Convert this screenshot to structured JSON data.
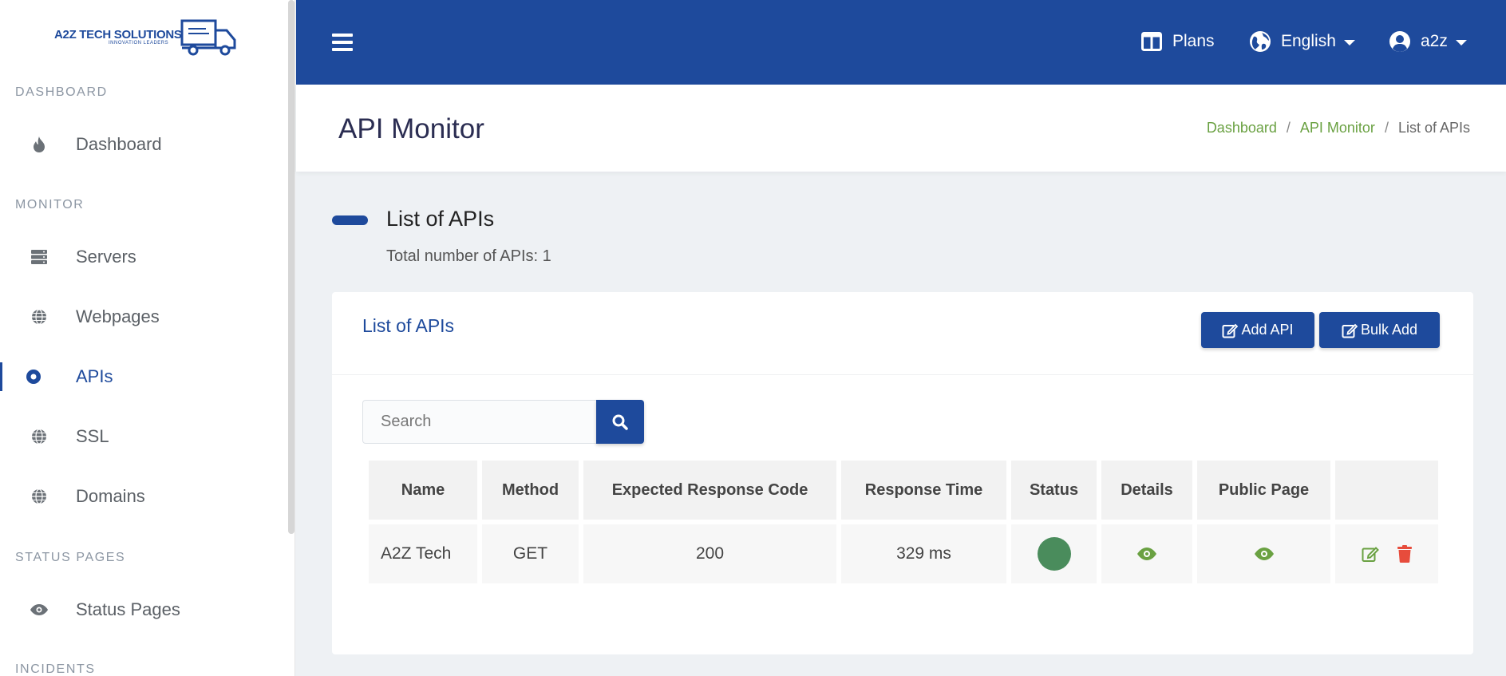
{
  "colors": {
    "primary": "#1e4a9c",
    "accent_green": "#6aa142",
    "status_up": "#4a8c5c",
    "danger": "#e74c3c"
  },
  "logo": {
    "brand": "A2Z TECH SOLUTIONS",
    "tagline": "INNOVATION LEADERS"
  },
  "sidebar": {
    "sections": {
      "dashboard": "DASHBOARD",
      "monitor": "MONITOR",
      "status_pages": "STATUS PAGES",
      "incidents": "INCIDENTS"
    },
    "items": [
      {
        "label": "Dashboard",
        "icon": "fire-icon"
      },
      {
        "label": "Servers",
        "icon": "server-icon"
      },
      {
        "label": "Webpages",
        "icon": "globe-icon"
      },
      {
        "label": "APIs",
        "icon": "dot-circle-icon",
        "active": true
      },
      {
        "label": "SSL",
        "icon": "globe-icon"
      },
      {
        "label": "Domains",
        "icon": "globe-icon"
      },
      {
        "label": "Status Pages",
        "icon": "eye-icon"
      }
    ]
  },
  "topbar": {
    "plans": "Plans",
    "language": "English",
    "user": "a2z"
  },
  "header": {
    "title": "API Monitor",
    "breadcrumb": [
      "Dashboard",
      "API Monitor",
      "List of APIs"
    ]
  },
  "section": {
    "title": "List of APIs",
    "subtitle": "Total number of APIs: 1"
  },
  "card": {
    "title": "List of APIs",
    "add_button": "Add API",
    "bulk_button": "Bulk Add",
    "search_placeholder": "Search"
  },
  "table": {
    "headers": [
      "Name",
      "Method",
      "Expected Response Code",
      "Response Time",
      "Status",
      "Details",
      "Public Page",
      ""
    ],
    "rows": [
      {
        "name": "A2Z Tech",
        "method": "GET",
        "code": "200",
        "response_time": "329 ms",
        "status": "up"
      }
    ]
  }
}
